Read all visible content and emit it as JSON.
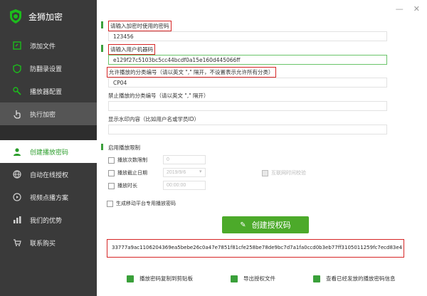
{
  "app": {
    "name": "金狮加密"
  },
  "window": {
    "minimize": "—",
    "close": "✕"
  },
  "sidebar": {
    "top_items": [
      {
        "label": "添加文件",
        "icon": "add-file-icon"
      },
      {
        "label": "防翻录设置",
        "icon": "shield-icon"
      },
      {
        "label": "播放器配置",
        "icon": "wrench-icon"
      },
      {
        "label": "执行加密",
        "icon": "hand-pointer-icon"
      }
    ],
    "bottom_items": [
      {
        "label": "创建播放密码",
        "icon": "user-icon"
      },
      {
        "label": "自动在线授权",
        "icon": "globe-icon"
      },
      {
        "label": "视频点播方案",
        "icon": "video-icon"
      },
      {
        "label": "我们的优势",
        "icon": "chart-icon"
      },
      {
        "label": "联系购买",
        "icon": "cart-icon"
      }
    ]
  },
  "form": {
    "password_label": "请输入加密时使用的密码",
    "password_value": "123456",
    "machine_code_label": "请输入用户机器码",
    "machine_code_value": "e129f27c5103bc5cc44bcdf0a15e160d445066ff",
    "allowed_group_label": "允许播放的分类编号（请以英文 \",\" 隔开，不设置表示允许所有分类）",
    "allowed_group_value": "CP04",
    "forbidden_group_label": "禁止播放的分类编号（请以英文 \",\" 隔开）",
    "forbidden_group_value": "",
    "watermark_label": "显示水印内容（比如用户名或学员ID）",
    "watermark_value": ""
  },
  "limits": {
    "section_label": "启用播放限制",
    "count_label": "播放次数限制",
    "count_value": "0",
    "date_label": "播放截止日期",
    "date_value": "2019/9/6",
    "net_time_label": "互联网时间校验",
    "duration_label": "播放时长",
    "duration_value": "00:00:00",
    "mobile_label": "生成移动平台专用播放密码"
  },
  "generate_button": "创建授权码",
  "result_code": "33777a9ac1106204369ea5bebe26c0a47e7851f81cfe258be78de9bc7d7a1fa0ccd0b3eb77ff3105011259fc7ecd83e4",
  "actions": {
    "copy": "播放密码复制到剪贴板",
    "export": "导出授权文件",
    "history": "查看已经发放的播放密码信息"
  },
  "colors": {
    "accent": "#4caa2a",
    "sidebar": "#3a3a3a",
    "highlight": "#d62626"
  }
}
